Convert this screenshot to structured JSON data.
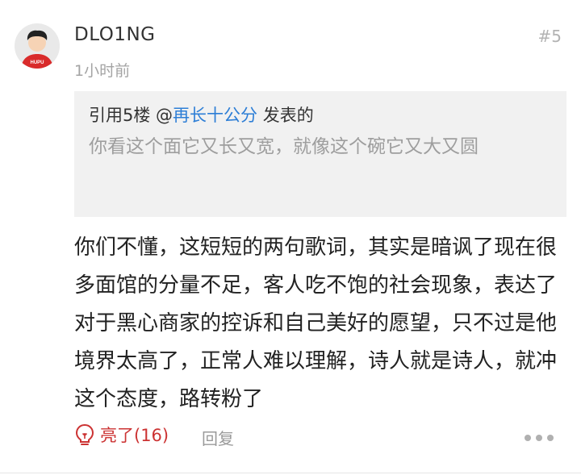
{
  "post": {
    "username": "DLO1NG",
    "time": "1小时前",
    "floor": "#5",
    "avatar_badge": "HUPU",
    "quote": {
      "prefix": "引用5楼 @",
      "mention": "再长十公分",
      "suffix": " 发表的",
      "text": "你看这个面它又长又宽，就像这个碗它又大又圆"
    },
    "content": "你们不懂，这短短的两句歌词，其实是暗讽了现在很多面馆的分量不足，客人吃不饱的社会现象，表达了对于黑心商家的控诉和自己美好的愿望，只不过是他境界太高了，正常人难以理解，诗人就是诗人，就冲这个态度，路转粉了",
    "actions": {
      "like_label": "亮了(16)",
      "reply_label": "回复"
    }
  },
  "colors": {
    "accent": "#c33333",
    "mention": "#2d7ed6"
  }
}
